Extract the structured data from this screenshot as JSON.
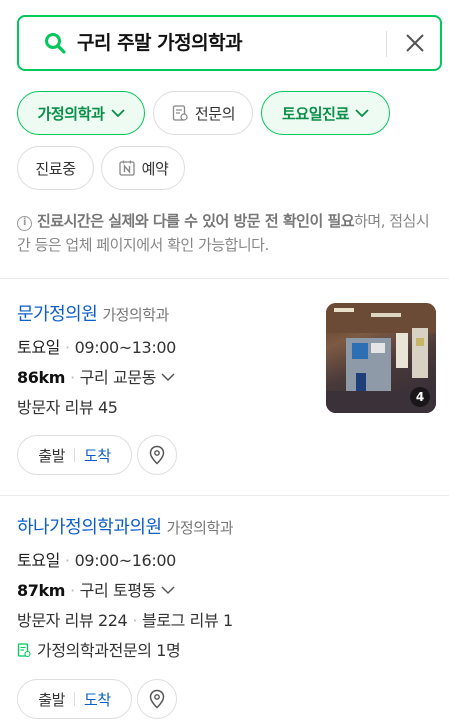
{
  "search": {
    "query": "구리 주말 가정의학과"
  },
  "filters": {
    "chips": [
      {
        "label": "가정의학과",
        "active": true,
        "has_dropdown": true
      },
      {
        "label": "전문의",
        "active": false,
        "icon": "doctor-doc-icon"
      },
      {
        "label": "토요일진료",
        "active": true,
        "has_dropdown": true
      },
      {
        "label": "진료중",
        "active": false
      },
      {
        "label": "예약",
        "active": false,
        "icon": "naver-n-icon"
      }
    ]
  },
  "notice": {
    "bold": "진료시간은 실제와 다를 수 있어 방문 전 확인이 필요",
    "rest": "하며, 점심시간 등은 업체 페이지에서 확인 가능합니다."
  },
  "results": [
    {
      "name": "문가정의원",
      "category": "가정의학과",
      "hours_day": "토요일",
      "hours_time": "09:00~13:00",
      "distance": "86km",
      "area": "구리 교문동",
      "reviews": "방문자 리뷰 45",
      "photo_count": "4",
      "depart_label": "출발",
      "arrive_label": "도착"
    },
    {
      "name": "하나가정의학과의원",
      "category": "가정의학과",
      "hours_day": "토요일",
      "hours_time": "09:00~16:00",
      "distance": "87km",
      "area": "구리 토평동",
      "reviews": "방문자 리뷰 224",
      "blog_reviews": "블로그 리뷰 1",
      "specialist": "가정의학과전문의 1명",
      "depart_label": "출발",
      "arrive_label": "도착"
    }
  ],
  "colors": {
    "accent": "#03c75a",
    "link": "#0d5fc7"
  }
}
